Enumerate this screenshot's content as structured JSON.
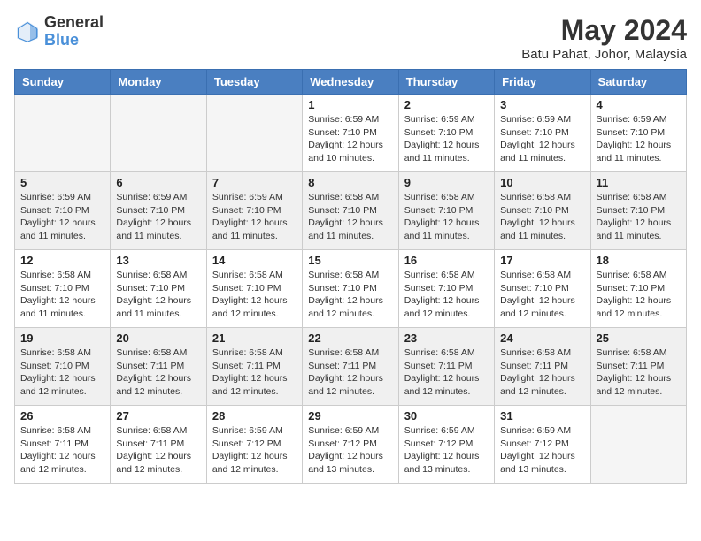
{
  "header": {
    "logo_general": "General",
    "logo_blue": "Blue",
    "month_title": "May 2024",
    "location": "Batu Pahat, Johor, Malaysia"
  },
  "days_of_week": [
    "Sunday",
    "Monday",
    "Tuesday",
    "Wednesday",
    "Thursday",
    "Friday",
    "Saturday"
  ],
  "weeks": [
    [
      {
        "num": "",
        "info": ""
      },
      {
        "num": "",
        "info": ""
      },
      {
        "num": "",
        "info": ""
      },
      {
        "num": "1",
        "info": "Sunrise: 6:59 AM\nSunset: 7:10 PM\nDaylight: 12 hours\nand 10 minutes."
      },
      {
        "num": "2",
        "info": "Sunrise: 6:59 AM\nSunset: 7:10 PM\nDaylight: 12 hours\nand 11 minutes."
      },
      {
        "num": "3",
        "info": "Sunrise: 6:59 AM\nSunset: 7:10 PM\nDaylight: 12 hours\nand 11 minutes."
      },
      {
        "num": "4",
        "info": "Sunrise: 6:59 AM\nSunset: 7:10 PM\nDaylight: 12 hours\nand 11 minutes."
      }
    ],
    [
      {
        "num": "5",
        "info": "Sunrise: 6:59 AM\nSunset: 7:10 PM\nDaylight: 12 hours\nand 11 minutes."
      },
      {
        "num": "6",
        "info": "Sunrise: 6:59 AM\nSunset: 7:10 PM\nDaylight: 12 hours\nand 11 minutes."
      },
      {
        "num": "7",
        "info": "Sunrise: 6:59 AM\nSunset: 7:10 PM\nDaylight: 12 hours\nand 11 minutes."
      },
      {
        "num": "8",
        "info": "Sunrise: 6:58 AM\nSunset: 7:10 PM\nDaylight: 12 hours\nand 11 minutes."
      },
      {
        "num": "9",
        "info": "Sunrise: 6:58 AM\nSunset: 7:10 PM\nDaylight: 12 hours\nand 11 minutes."
      },
      {
        "num": "10",
        "info": "Sunrise: 6:58 AM\nSunset: 7:10 PM\nDaylight: 12 hours\nand 11 minutes."
      },
      {
        "num": "11",
        "info": "Sunrise: 6:58 AM\nSunset: 7:10 PM\nDaylight: 12 hours\nand 11 minutes."
      }
    ],
    [
      {
        "num": "12",
        "info": "Sunrise: 6:58 AM\nSunset: 7:10 PM\nDaylight: 12 hours\nand 11 minutes."
      },
      {
        "num": "13",
        "info": "Sunrise: 6:58 AM\nSunset: 7:10 PM\nDaylight: 12 hours\nand 11 minutes."
      },
      {
        "num": "14",
        "info": "Sunrise: 6:58 AM\nSunset: 7:10 PM\nDaylight: 12 hours\nand 12 minutes."
      },
      {
        "num": "15",
        "info": "Sunrise: 6:58 AM\nSunset: 7:10 PM\nDaylight: 12 hours\nand 12 minutes."
      },
      {
        "num": "16",
        "info": "Sunrise: 6:58 AM\nSunset: 7:10 PM\nDaylight: 12 hours\nand 12 minutes."
      },
      {
        "num": "17",
        "info": "Sunrise: 6:58 AM\nSunset: 7:10 PM\nDaylight: 12 hours\nand 12 minutes."
      },
      {
        "num": "18",
        "info": "Sunrise: 6:58 AM\nSunset: 7:10 PM\nDaylight: 12 hours\nand 12 minutes."
      }
    ],
    [
      {
        "num": "19",
        "info": "Sunrise: 6:58 AM\nSunset: 7:10 PM\nDaylight: 12 hours\nand 12 minutes."
      },
      {
        "num": "20",
        "info": "Sunrise: 6:58 AM\nSunset: 7:11 PM\nDaylight: 12 hours\nand 12 minutes."
      },
      {
        "num": "21",
        "info": "Sunrise: 6:58 AM\nSunset: 7:11 PM\nDaylight: 12 hours\nand 12 minutes."
      },
      {
        "num": "22",
        "info": "Sunrise: 6:58 AM\nSunset: 7:11 PM\nDaylight: 12 hours\nand 12 minutes."
      },
      {
        "num": "23",
        "info": "Sunrise: 6:58 AM\nSunset: 7:11 PM\nDaylight: 12 hours\nand 12 minutes."
      },
      {
        "num": "24",
        "info": "Sunrise: 6:58 AM\nSunset: 7:11 PM\nDaylight: 12 hours\nand 12 minutes."
      },
      {
        "num": "25",
        "info": "Sunrise: 6:58 AM\nSunset: 7:11 PM\nDaylight: 12 hours\nand 12 minutes."
      }
    ],
    [
      {
        "num": "26",
        "info": "Sunrise: 6:58 AM\nSunset: 7:11 PM\nDaylight: 12 hours\nand 12 minutes."
      },
      {
        "num": "27",
        "info": "Sunrise: 6:58 AM\nSunset: 7:11 PM\nDaylight: 12 hours\nand 12 minutes."
      },
      {
        "num": "28",
        "info": "Sunrise: 6:59 AM\nSunset: 7:12 PM\nDaylight: 12 hours\nand 12 minutes."
      },
      {
        "num": "29",
        "info": "Sunrise: 6:59 AM\nSunset: 7:12 PM\nDaylight: 12 hours\nand 13 minutes."
      },
      {
        "num": "30",
        "info": "Sunrise: 6:59 AM\nSunset: 7:12 PM\nDaylight: 12 hours\nand 13 minutes."
      },
      {
        "num": "31",
        "info": "Sunrise: 6:59 AM\nSunset: 7:12 PM\nDaylight: 12 hours\nand 13 minutes."
      },
      {
        "num": "",
        "info": ""
      }
    ]
  ]
}
